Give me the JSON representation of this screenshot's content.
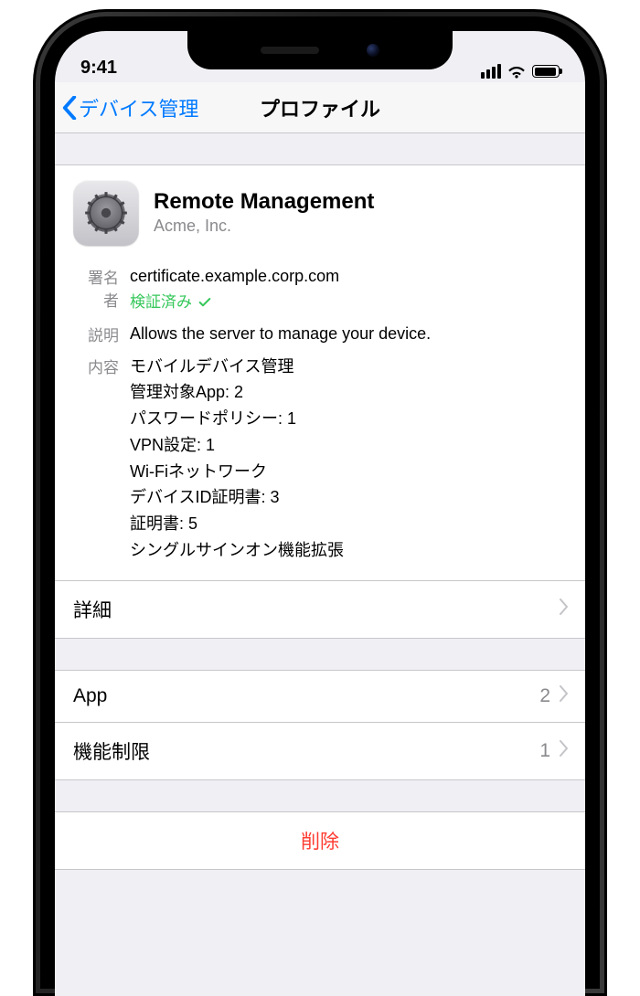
{
  "status": {
    "time": "9:41"
  },
  "nav": {
    "back": "デバイス管理",
    "title": "プロファイル"
  },
  "profile": {
    "name": "Remote Management",
    "org": "Acme, Inc.",
    "signer_label": "署名者",
    "signer_value": "certificate.example.corp.com",
    "verified_label": "検証済み",
    "desc_label": "説明",
    "desc_value": "Allows the server to manage your device.",
    "contents_label": "内容",
    "contents": [
      "モバイルデバイス管理",
      "管理対象App: 2",
      "パスワードポリシー: 1",
      "VPN設定: 1",
      "Wi-Fiネットワーク",
      "デバイスID証明書: 3",
      "証明書: 5",
      "シングルサインオン機能拡張"
    ]
  },
  "rows": {
    "details_label": "詳細",
    "app_label": "App",
    "app_count": "2",
    "restrictions_label": "機能制限",
    "restrictions_count": "1",
    "delete_label": "削除"
  }
}
